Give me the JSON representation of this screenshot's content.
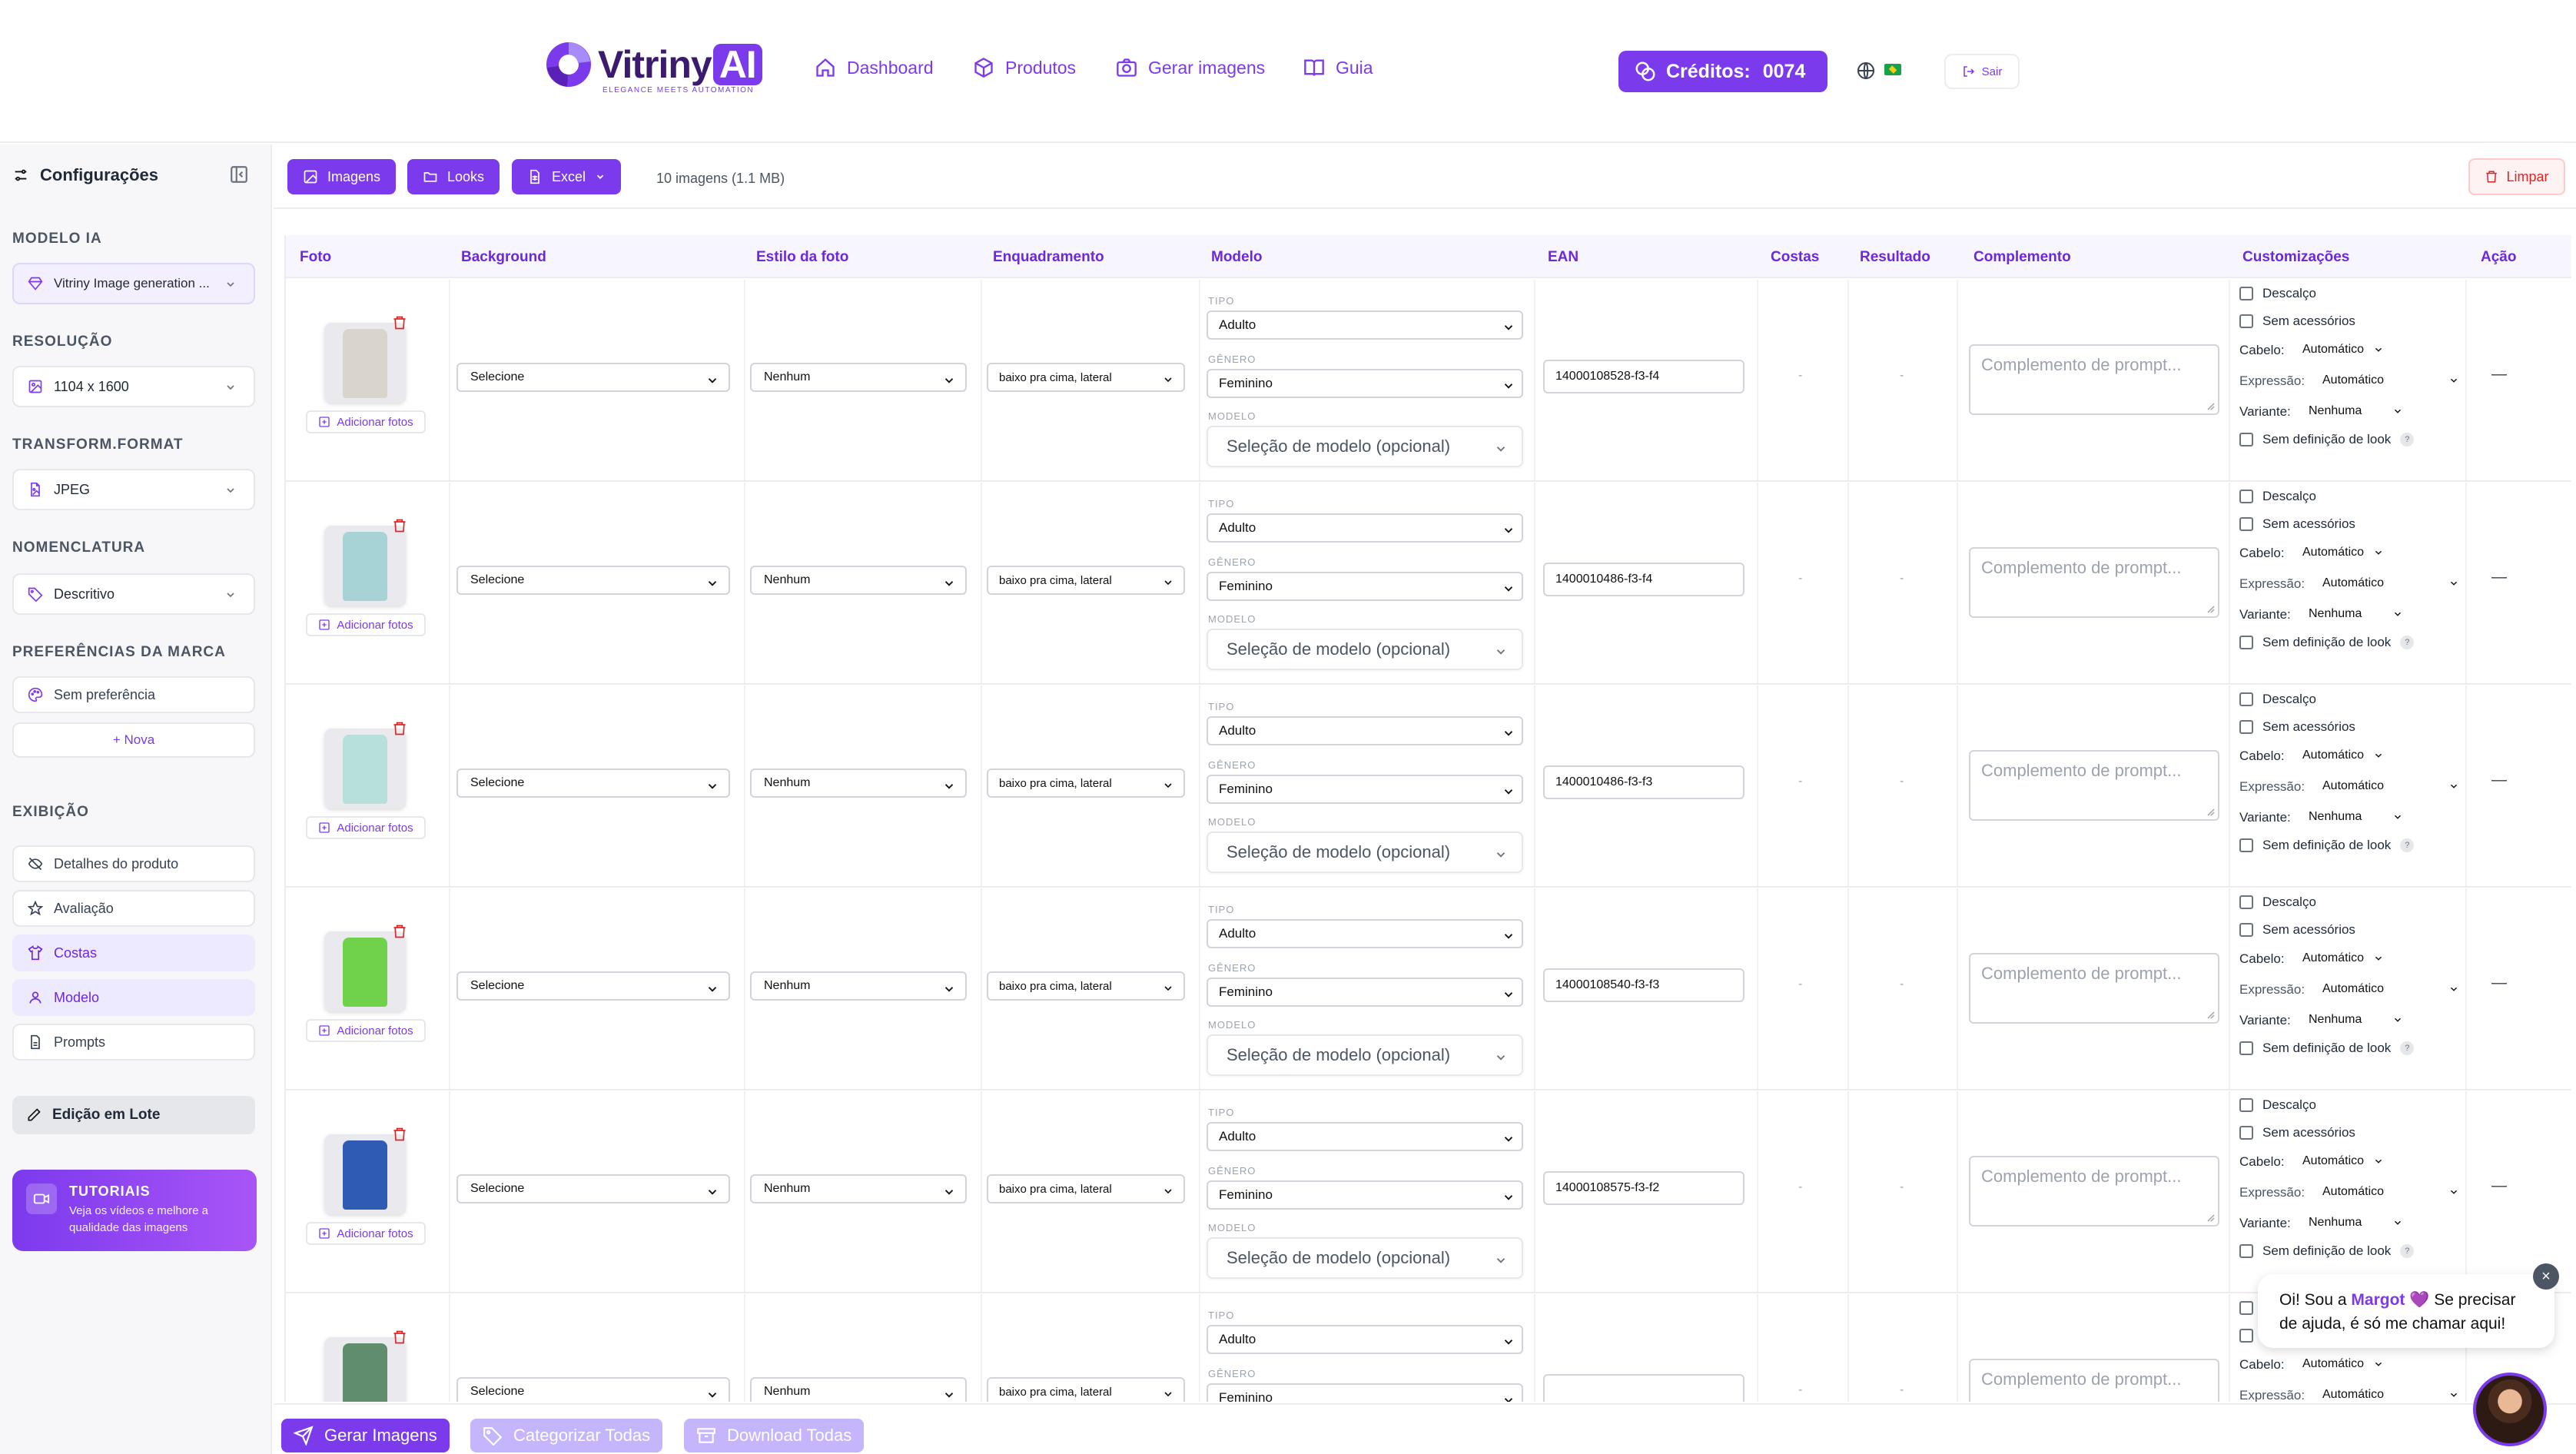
{
  "header": {
    "logo_word": "Vitriny",
    "logo_ai": "AI",
    "logo_tag": "ELEGANCE MEETS AUTOMATION",
    "nav": [
      {
        "label": "Dashboard",
        "icon": "home-icon"
      },
      {
        "label": "Produtos",
        "icon": "box-icon"
      },
      {
        "label": "Gerar imagens",
        "icon": "camera-icon"
      },
      {
        "label": "Guia",
        "icon": "book-icon"
      }
    ],
    "credits_label": "Créditos:",
    "credits_value": "0074",
    "logout_label": "Sair"
  },
  "sidebar": {
    "title": "Configurações",
    "modelo_ia_label": "MODELO IA",
    "modelo_ia_value": "Vitriny Image generation ...",
    "resolucao_label": "RESOLUÇÃO",
    "resolucao_value": "1104 x 1600",
    "format_label": "TRANSFORM.FORMAT",
    "format_value": "JPEG",
    "nomenclatura_label": "NOMENCLATURA",
    "nomenclatura_value": "Descritivo",
    "preferencias_label": "PREFERÊNCIAS DA MARCA",
    "preferencias_value": "Sem preferência",
    "nova_label": "+ Nova",
    "exibicao_label": "EXIBIÇÃO",
    "exibicao_items": [
      {
        "label": "Detalhes do produto",
        "active": false
      },
      {
        "label": "Avaliação",
        "active": false
      },
      {
        "label": "Costas",
        "active": true
      },
      {
        "label": "Modelo",
        "active": true
      },
      {
        "label": "Prompts",
        "active": false
      }
    ],
    "lote_label": "Edição em Lote",
    "tutorials_title": "TUTORIAIS",
    "tutorials_desc": "Veja os vídeos e melhore a qualidade das imagens"
  },
  "toolbar": {
    "images_label": "Imagens",
    "looks_label": "Looks",
    "excel_label": "Excel",
    "count_label": "10 imagens (1.1 MB)",
    "clear_label": "Limpar"
  },
  "table": {
    "columns": [
      "Foto",
      "Background",
      "Estilo da foto",
      "Enquadramento",
      "Modelo",
      "EAN",
      "Costas",
      "Resultado",
      "Complemento",
      "Customizações",
      "Ação"
    ],
    "add_photos_label": "Adicionar fotos",
    "tipo_label": "TIPO",
    "genero_label": "GÊNERO",
    "modelo_label": "MODELO",
    "model_placeholder": "Seleção de modelo (opcional)",
    "complement_placeholder": "Complemento de prompt...",
    "cust": {
      "descalco": "Descalço",
      "sem_acessorios": "Sem acessórios",
      "cabelo": "Cabelo:",
      "expressao": "Expressão:",
      "variante": "Variante:",
      "sem_definicao": "Sem definição de look",
      "auto": "Automático",
      "nenhuma": "Nenhuma",
      "help": "?"
    },
    "empty": "-",
    "action": "—",
    "rows": [
      {
        "background": "Selecione",
        "estilo": "Nenhum",
        "enquadramento": "baixo pra cima, lateral",
        "tipo": "Adulto",
        "genero": "Feminino",
        "ean": "14000108528-f3-f4",
        "color": "#d9d5cc"
      },
      {
        "background": "Selecione",
        "estilo": "Nenhum",
        "enquadramento": "baixo pra cima, lateral",
        "tipo": "Adulto",
        "genero": "Feminino",
        "ean": "1400010486-f3-f4",
        "color": "#a7d3d6"
      },
      {
        "background": "Selecione",
        "estilo": "Nenhum",
        "enquadramento": "baixo pra cima, lateral",
        "tipo": "Adulto",
        "genero": "Feminino",
        "ean": "1400010486-f3-f3",
        "color": "#b7e0db"
      },
      {
        "background": "Selecione",
        "estilo": "Nenhum",
        "enquadramento": "baixo pra cima, lateral",
        "tipo": "Adulto",
        "genero": "Feminino",
        "ean": "14000108540-f3-f3",
        "color": "#6fd24a"
      },
      {
        "background": "Selecione",
        "estilo": "Nenhum",
        "enquadramento": "baixo pra cima, lateral",
        "tipo": "Adulto",
        "genero": "Feminino",
        "ean": "14000108575-f3-f2",
        "color": "#2f5bb5"
      },
      {
        "background": "Selecione",
        "estilo": "Nenhum",
        "enquadramento": "baixo pra cima, lateral",
        "tipo": "Adulto",
        "genero": "Feminino",
        "ean": "",
        "color": "#5f8d6d"
      }
    ]
  },
  "bottom": {
    "generate_label": "Gerar Imagens",
    "categorize_label": "Categorizar Todas",
    "download_label": "Download Todas"
  },
  "chat": {
    "pre": "Oi! Sou a ",
    "name": "Margot",
    "heart": "💜",
    "post": " Se precisar de ajuda, é só me chamar aqui!",
    "close": "×"
  },
  "colors": {
    "accent": "#7c3aed",
    "danger": "#dc2626"
  }
}
